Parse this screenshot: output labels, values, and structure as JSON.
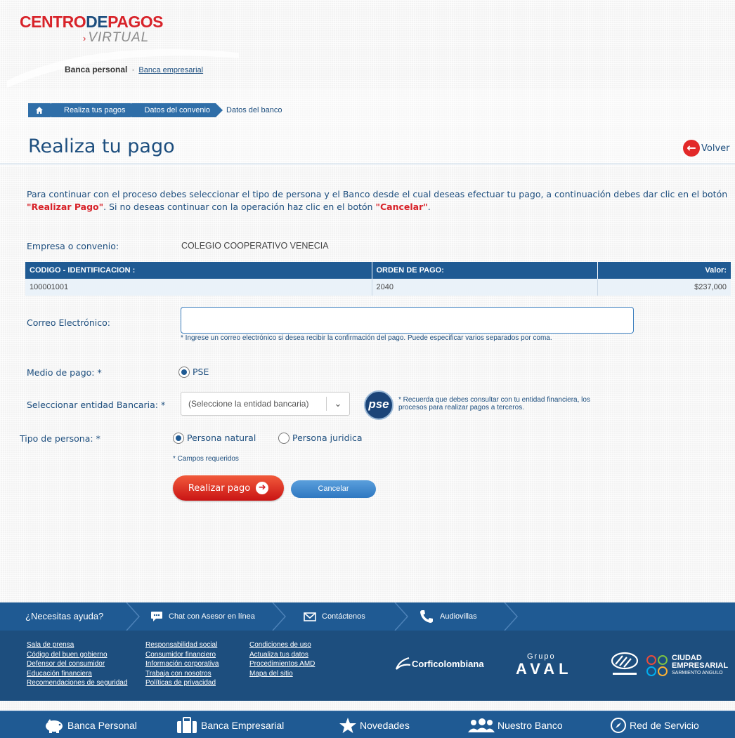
{
  "header": {
    "logo_line1_red": "CENTRO",
    "logo_line1_blue": "DE",
    "logo_line1_red2": "PAGOS",
    "logo_line2": "VIRTUAL",
    "nav_personal": "Banca personal",
    "nav_sep": "·",
    "nav_empresarial": "Banca empresarial"
  },
  "breadcrumb": {
    "items": [
      "Realiza tus pagos",
      "Datos del convenio",
      "Datos del banco"
    ]
  },
  "page": {
    "title": "Realiza tu pago",
    "back_label": "Volver",
    "intro_part1": "Para continuar con el proceso debes seleccionar el tipo de persona y el Banco desde el cual deseas efectuar tu pago, a continuación debes dar clic en el botón ",
    "intro_hl1": "\"Realizar Pago\"",
    "intro_part2": ". Si no deseas continuar con la operación haz clic en el botón ",
    "intro_hl2": "\"Cancelar\"",
    "intro_part3": "."
  },
  "payment": {
    "empresa_label": "Empresa o convenio:",
    "empresa_value": "COLEGIO COOPERATIVO VENECIA",
    "table": {
      "headers": [
        "CODIGO - IDENTIFICACION :",
        "ORDEN DE PAGO:",
        "Valor:"
      ],
      "row": [
        "100001001",
        "2040",
        "$237,000"
      ]
    }
  },
  "form": {
    "email_label": "Correo Electrónico:",
    "email_value": "",
    "email_hint": "* Ingrese un correo electrónico si desea recibir la confirmación del pago. Puede especificar varios separados por coma.",
    "medio_label": "Medio de pago: *",
    "medio_option": "PSE",
    "entidad_label": "Seleccionar entidad Bancaria: *",
    "entidad_selected": "(Seleccione la entidad bancaria)",
    "pse_logo_text": "pse",
    "pse_note": "* Recuerda que debes consultar con tu entidad financiera,   los procesos para realizar pagos a terceros.",
    "tipo_label": "Tipo de persona: *",
    "tipo_natural": "Persona natural",
    "tipo_juridica": "Persona juridica",
    "required_note": "* Campos requeridos",
    "pay_button": "Realizar pago",
    "cancel_button": "Cancelar"
  },
  "footer": {
    "help_title": "¿Necesitas ayuda?",
    "chat": "Chat con Asesor en línea",
    "contact": "Contáctenos",
    "audio": "Audiovillas",
    "col1": [
      "Sala de prensa",
      "Código del buen gobierno",
      "Defensor del consumidor",
      "Educación financiera",
      "Recomendaciones de seguridad"
    ],
    "col2": [
      "Responsabilidad social",
      "Consumidor financiero",
      "Información corporativa",
      "Trabaja con nosotros",
      "Políticas de privacidad"
    ],
    "col3": [
      "Condiciones de uso",
      "Actualiza tus datos",
      "Procedimientos AMD",
      "Mapa del sitio"
    ],
    "corficolombiana": "Corficolombiana",
    "grupo": "Grupo",
    "aval": "AVAL",
    "ciudad1": "CIUDAD",
    "ciudad2": "EMPRESARIAL",
    "ciudad3": "SARMIENTO ANGULO",
    "nav": [
      "Banca Personal",
      "Banca Empresarial",
      "Novedades",
      "Nuestro Banco",
      "Red de Servicio"
    ]
  },
  "colors": {
    "brand_blue": "#1d4e7e",
    "accent_red": "#d8232a",
    "table_header": "#1f5a93",
    "cancel_blue": "#3b86cf"
  }
}
